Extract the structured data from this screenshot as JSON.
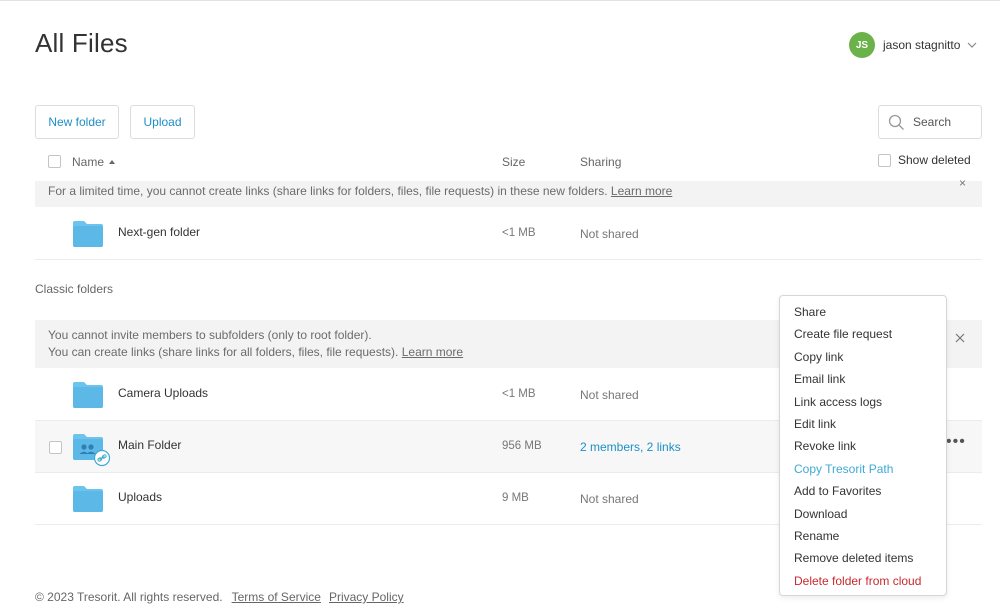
{
  "header": {
    "title": "All Files",
    "user": {
      "initials": "JS",
      "name": "jason stagnitto",
      "avatar_color": "#6bb24a"
    }
  },
  "toolbar": {
    "new_folder_label": "New folder",
    "upload_label": "Upload",
    "search_placeholder": "Search"
  },
  "table_header": {
    "name": "Name",
    "size": "Size",
    "sharing": "Sharing",
    "show_deleted": "Show deleted"
  },
  "notices": {
    "nextgen": {
      "text": "For a limited time, you cannot create links (share links for folders, files, file requests) in these new folders.",
      "link": "Learn more"
    },
    "classic": {
      "line1": "You cannot invite members to subfolders (only to root folder).",
      "line2": "You can create links (share links for all folders, files, file requests).",
      "link": "Learn more"
    }
  },
  "nextgen_files": [
    {
      "name": "Next-gen folder",
      "size": "<1 MB",
      "sharing": "Not shared"
    }
  ],
  "classic_label": "Classic folders",
  "classic_files": [
    {
      "name": "Camera Uploads",
      "size": "<1 MB",
      "sharing": "Not shared"
    },
    {
      "name": "Main Folder",
      "size": "956 MB",
      "sharing": "2 members, 2 links"
    },
    {
      "name": "Uploads",
      "size": "9 MB",
      "sharing": "Not shared"
    }
  ],
  "context_menu": {
    "items": [
      "Share",
      "Create file request",
      "Copy link",
      "Email link",
      "Link access logs",
      "Edit link",
      "Revoke link",
      "Copy Tresorit Path",
      "Add to Favorites",
      "Download",
      "Rename",
      "Remove deleted items",
      "Delete folder from cloud"
    ]
  },
  "footer": {
    "copyright": "© 2023 Tresorit. All rights reserved.",
    "terms": "Terms of Service",
    "privacy": "Privacy Policy"
  },
  "colors": {
    "accent": "#1d8fc7",
    "folder": "#6cc3ee",
    "danger": "#c72a30",
    "highlight": "#3fa9d6"
  },
  "icons": {
    "folder": "folder-icon",
    "shared_folder": "shared-folder-icon",
    "link_badge": "link-badge-icon",
    "search": "search-icon",
    "chevron": "chevron-down-icon",
    "close": "close-icon",
    "more": "more-options-icon"
  }
}
